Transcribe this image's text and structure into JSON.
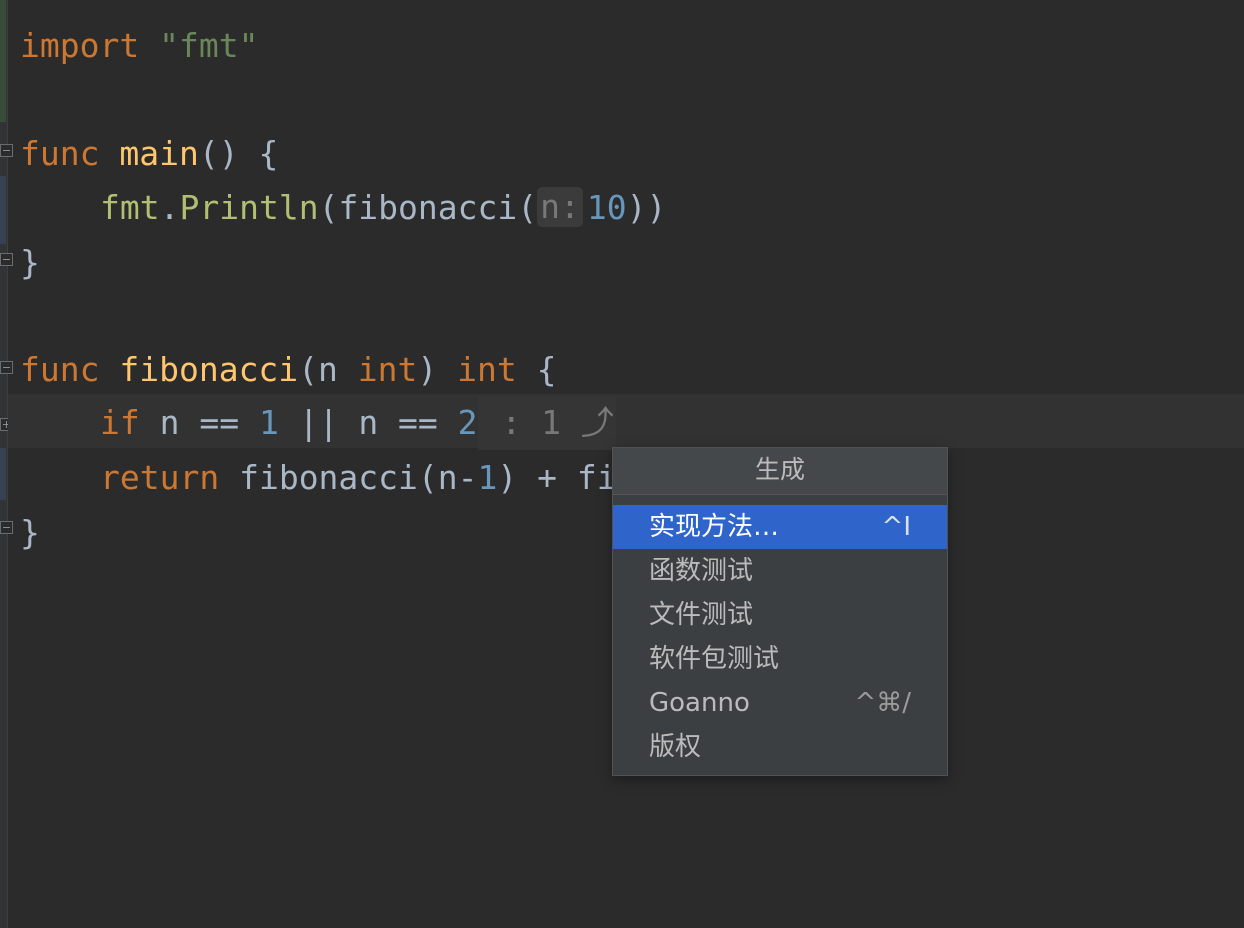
{
  "editor": {
    "lines": {
      "l1": {
        "kw": "import",
        "str": "\"fmt\""
      },
      "l3": {
        "kw": "func",
        "name": "main",
        "rest": "() {"
      },
      "l4": {
        "pkg": "fmt",
        "dot": ".",
        "call1": "Println",
        "p1": "(",
        "call2": "fibonacci",
        "p2": "(",
        "hint": "n:",
        "num": "10",
        "p3": "))"
      },
      "l5": {
        "brace": "}"
      },
      "l7": {
        "kw": "func",
        "name": "fibonacci",
        "p1": "(n ",
        "type1": "int",
        "p2": ") ",
        "type2": "int",
        "p3": " {"
      },
      "l8": {
        "kw": "if",
        "t1": " n == ",
        "n1": "1",
        "t2": " || n == ",
        "n2": "2",
        "inlay": " : 1 ⤴"
      },
      "l9": {
        "kw": "return",
        "t1": " fibonacci(n-",
        "n1": "1",
        "t2": ") + fi"
      },
      "l10": {
        "brace": "}"
      }
    }
  },
  "popup": {
    "title": "生成",
    "items": [
      {
        "label": "实现方法…",
        "shortcut": "^I",
        "selected": true
      },
      {
        "label": "函数测试",
        "shortcut": ""
      },
      {
        "label": "文件测试",
        "shortcut": ""
      },
      {
        "label": "软件包测试",
        "shortcut": ""
      },
      {
        "label": "Goanno",
        "shortcut": "^⌘/"
      },
      {
        "label": "版权",
        "shortcut": ""
      }
    ]
  },
  "colors": {
    "background": "#2b2b2b",
    "keyword": "#cc7832",
    "string": "#6a8759",
    "function": "#ffc66d",
    "number": "#6897bb",
    "selection": "#2f65ca"
  }
}
